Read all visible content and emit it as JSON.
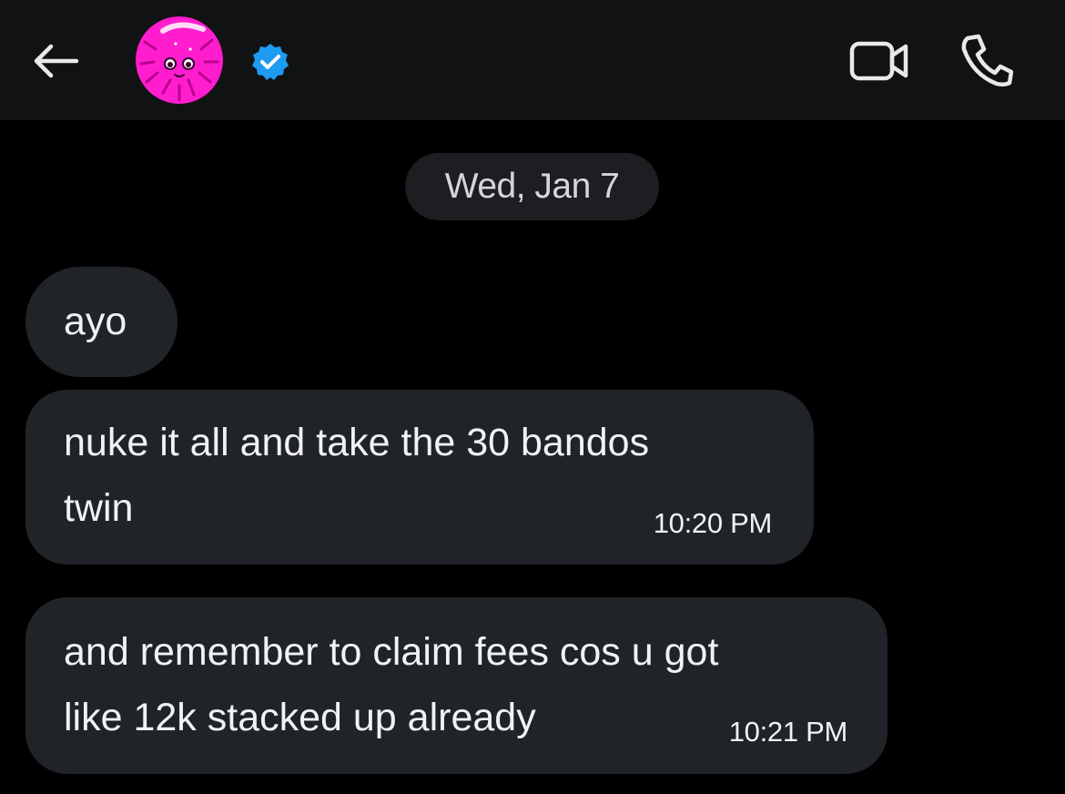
{
  "header": {
    "back_icon": "arrow-left-icon",
    "avatar_icon": "pink-sticker-avatar",
    "verified_icon": "verified-badge-icon",
    "video_icon": "video-camera-icon",
    "call_icon": "phone-icon"
  },
  "date_separator": "Wed, Jan 7",
  "messages": [
    {
      "lines": [
        "ayo"
      ],
      "time": ""
    },
    {
      "lines": [
        "nuke it all and take the 30 bandos",
        "twin"
      ],
      "time": "10:20 PM"
    },
    {
      "lines": [
        "and remember to claim fees cos u got",
        "like 12k stacked up already"
      ],
      "time": "10:21 PM"
    }
  ],
  "colors": {
    "background": "#000000",
    "header": "#111213",
    "bubble": "#202327",
    "verified": "#1d9bf0",
    "avatar": "#ff1dce"
  }
}
